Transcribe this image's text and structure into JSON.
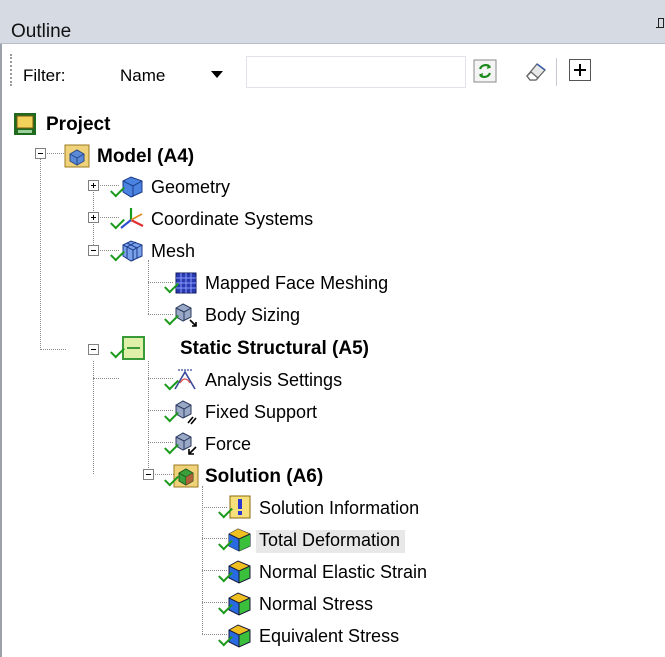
{
  "panel": {
    "title": "Outline"
  },
  "filter": {
    "label": "Filter:",
    "selected_option": "Name",
    "search_value": ""
  },
  "tree": {
    "project": {
      "label": "Project"
    },
    "model": {
      "label": "Model (A4)"
    },
    "geometry": {
      "label": "Geometry"
    },
    "coordinate_systems": {
      "label": "Coordinate Systems"
    },
    "mesh": {
      "label": "Mesh"
    },
    "mapped_face_meshing": {
      "label": "Mapped Face Meshing"
    },
    "body_sizing": {
      "label": "Body Sizing"
    },
    "static_structural": {
      "label": "Static Structural (A5)"
    },
    "analysis_settings": {
      "label": "Analysis Settings"
    },
    "fixed_support": {
      "label": "Fixed Support"
    },
    "force": {
      "label": "Force"
    },
    "solution": {
      "label": "Solution (A6)"
    },
    "solution_information": {
      "label": "Solution Information"
    },
    "total_deformation": {
      "label": "Total Deformation",
      "selected": true
    },
    "normal_elastic_strain": {
      "label": "Normal Elastic Strain"
    },
    "normal_stress": {
      "label": "Normal Stress"
    },
    "equivalent_stress": {
      "label": "Equivalent Stress"
    }
  },
  "colors": {
    "title_bar": "#d5dae3",
    "check_green": "#1a9a1a",
    "selection": "#e8e8e8"
  }
}
